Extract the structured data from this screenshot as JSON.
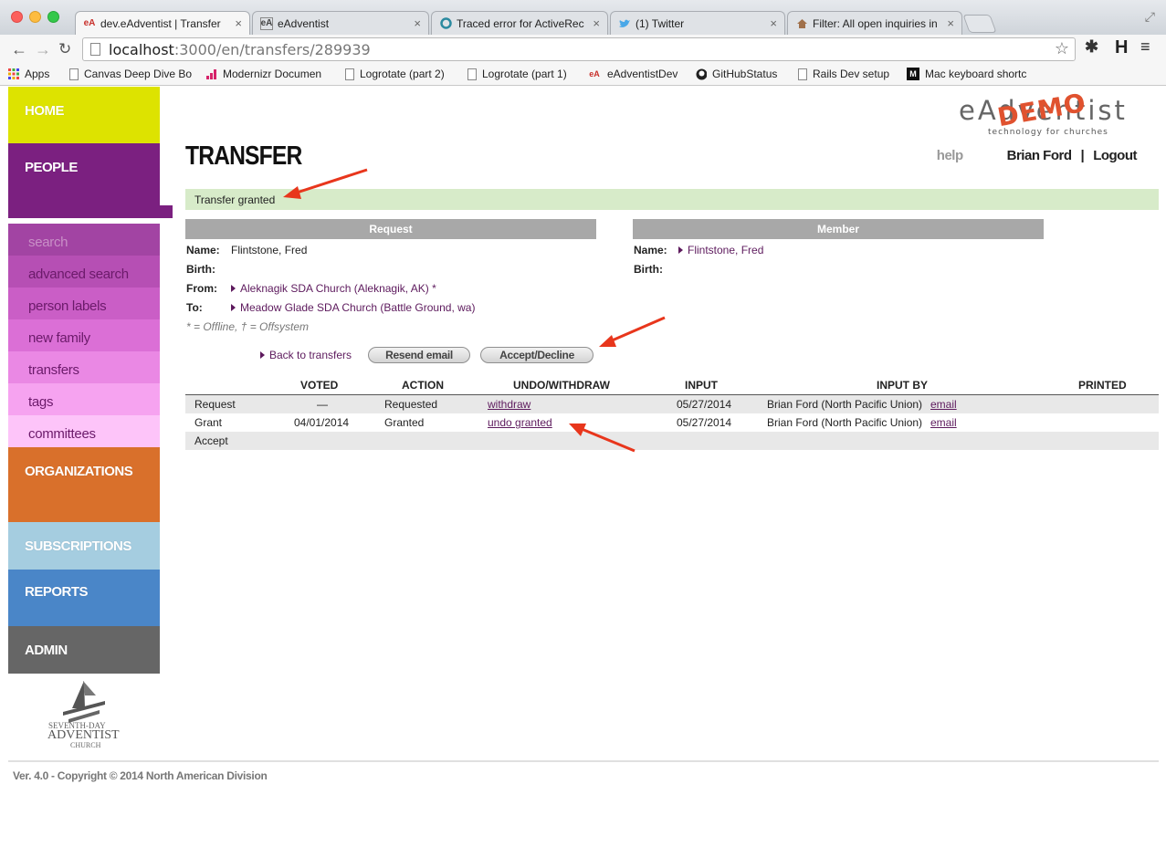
{
  "browser": {
    "tabs": [
      {
        "label": "dev.eAdventist | Transfer",
        "favicon": "eA",
        "active": true
      },
      {
        "label": "eAdventist",
        "favicon": "eA",
        "active": false
      },
      {
        "label": "Traced error for ActiveRec",
        "favicon": "circle-icon",
        "active": false
      },
      {
        "label": "(1) Twitter",
        "favicon": "twitter-bird-icon",
        "active": false
      },
      {
        "label": "Filter: All open inquiries in",
        "favicon": "house-icon",
        "active": false
      }
    ],
    "address": {
      "host": "localhost",
      "path": ":3000/en/transfers/289939"
    },
    "extension_label": "H",
    "bookmarks": [
      {
        "label": "Apps",
        "icon": "apps-grid-icon"
      },
      {
        "label": "Canvas Deep Dive Bo",
        "icon": "doc-icon"
      },
      {
        "label": "Modernizr Documen",
        "icon": "modernizr-icon"
      },
      {
        "label": "Logrotate (part 2)",
        "icon": "doc-icon"
      },
      {
        "label": "Logrotate (part 1)",
        "icon": "doc-icon"
      },
      {
        "label": "eAdventistDev",
        "icon": "eA"
      },
      {
        "label": "GitHubStatus",
        "icon": "github-icon"
      },
      {
        "label": "Rails Dev setup",
        "icon": "doc-icon"
      },
      {
        "label": "Mac keyboard shortc",
        "icon": "M"
      }
    ]
  },
  "sidebar": {
    "home": "HOME",
    "people": "PEOPLE",
    "people_items": [
      "search",
      "advanced search",
      "person labels",
      "new family",
      "transfers",
      "tags",
      "committees"
    ],
    "organizations": "ORGANIZATIONS",
    "subscriptions": "SUBSCRIPTIONS",
    "reports": "REPORTS",
    "admin": "ADMIN",
    "church_logo": {
      "line1": "SEVENTH-DAY",
      "line2": "ADVENTIST",
      "line3": "CHURCH"
    },
    "colors": {
      "home": "#dde300",
      "people": "#7b2080",
      "organizations": "#d9702b",
      "subscriptions": "#a5cde0",
      "reports": "#4a86c8",
      "admin": "#666666"
    }
  },
  "header": {
    "title": "TRANSFER",
    "logo": {
      "word": "eAdventist",
      "stamp": "DEMO",
      "tagline": "technology for churches"
    },
    "help": "help",
    "user": "Brian Ford",
    "separator": "|",
    "logout": "Logout"
  },
  "flash": "Transfer granted",
  "request": {
    "heading": "Request",
    "name_label": "Name:",
    "name": "Flintstone, Fred",
    "birth_label": "Birth:",
    "from_label": "From:",
    "from": "Aleknagik SDA Church (Aleknagik, AK) *",
    "to_label": "To:",
    "to": "Meadow Glade SDA Church (Battle Ground, wa)"
  },
  "member": {
    "heading": "Member",
    "name_label": "Name:",
    "name": "Flintstone, Fred",
    "birth_label": "Birth:"
  },
  "legend": "* = Offline, † = Offsystem",
  "actions": {
    "back": "Back to transfers",
    "resend": "Resend email",
    "accept_decline": "Accept/Decline"
  },
  "history": {
    "columns": [
      "VOTED",
      "ACTION",
      "UNDO/WITHDRAW",
      "INPUT",
      "INPUT BY",
      "PRINTED"
    ],
    "rows": [
      {
        "step": "Request",
        "voted": "—",
        "action": "Requested",
        "undo": "withdraw",
        "input": "05/27/2014",
        "input_by": "Brian Ford (North Pacific Union)",
        "email": "email"
      },
      {
        "step": "Grant",
        "voted": "04/01/2014",
        "action": "Granted",
        "undo": "undo granted",
        "input": "05/27/2014",
        "input_by": "Brian Ford (North Pacific Union)",
        "email": "email"
      },
      {
        "step": "Accept",
        "voted": "",
        "action": "",
        "undo": "",
        "input": "",
        "input_by": "",
        "email": ""
      }
    ]
  },
  "footer": "Ver. 4.0 - Copyright © 2014 North American Division"
}
